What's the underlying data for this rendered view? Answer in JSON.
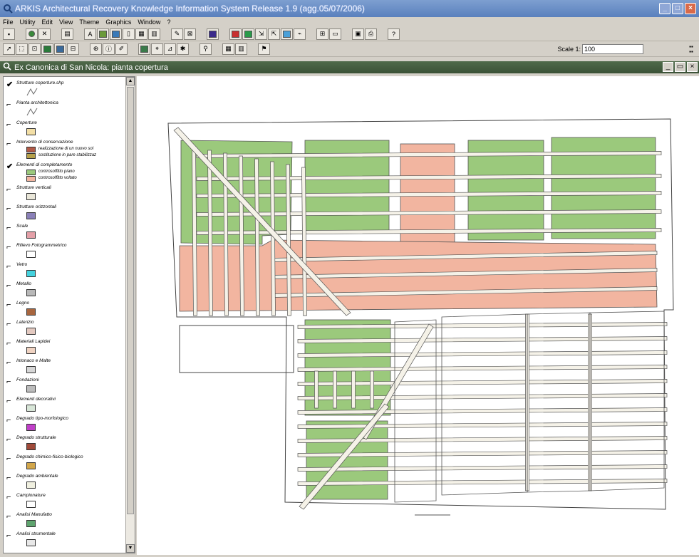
{
  "window": {
    "title": "ARKIS  Architectural Recovery Knowledge Information System      Release 1.9  (agg.05/07/2006)",
    "icon": "app-icon"
  },
  "menu": [
    "File",
    "Utility",
    "Edit",
    "View",
    "Theme",
    "Graphics",
    "Window",
    "?"
  ],
  "toolbar": {
    "scale_label": "Scale 1:",
    "scale_value": "100"
  },
  "map_window": {
    "title": "Ex Canonica di San Nicola: pianta copertura"
  },
  "legend": {
    "items": [
      {
        "label": "Strutture coperture.shp",
        "checked": true,
        "swatch_type": "line",
        "color": "#6b6b6b"
      },
      {
        "label": "Pianta architettonica",
        "checked": false,
        "swatch_type": "line",
        "color": "#6b6b6b"
      },
      {
        "label": "Coperture",
        "checked": false,
        "swatch_type": "fill",
        "color": "#f3dfa6"
      },
      {
        "label": "Intervento di conservazione",
        "checked": false,
        "swatch_type": "group",
        "subitems": [
          {
            "label": "realizzazione di un nuovo sol",
            "color": "#b25a47"
          },
          {
            "label": "sostituzione in pare stabilizzaz",
            "color": "#b5a04a"
          }
        ]
      },
      {
        "label": "Elementi di completamento",
        "checked": true,
        "swatch_type": "group",
        "subitems": [
          {
            "label": "controsoffitto piano",
            "color": "#9bc97c"
          },
          {
            "label": "controsoffitto voltato",
            "color": "#f2b5a0"
          }
        ]
      },
      {
        "label": "Strutture verticali",
        "checked": false,
        "swatch_type": "fill",
        "color": "#e9e6d8"
      },
      {
        "label": "Strutture orizzontali",
        "checked": false,
        "swatch_type": "fill",
        "color": "#8a80b8"
      },
      {
        "label": "Scale",
        "checked": false,
        "swatch_type": "fill",
        "color": "#e4a0a8"
      },
      {
        "label": "Rilievo Fotogrammetrico",
        "checked": false,
        "swatch_type": "fill",
        "color": "#ffffff"
      },
      {
        "label": "Vetro",
        "checked": false,
        "swatch_type": "fill",
        "color": "#44d2de"
      },
      {
        "label": "Metallo",
        "checked": false,
        "swatch_type": "fill",
        "color": "#b8b8b8"
      },
      {
        "label": "Legno",
        "checked": false,
        "swatch_type": "fill",
        "color": "#a8663f"
      },
      {
        "label": "Laterizio",
        "checked": false,
        "swatch_type": "fill",
        "color": "#e3c9c0"
      },
      {
        "label": "Materiali Lapidei",
        "checked": false,
        "swatch_type": "fill",
        "color": "#f0d3c2"
      },
      {
        "label": "Intonaco e Malte",
        "checked": false,
        "swatch_type": "fill",
        "color": "#d6d6d6"
      },
      {
        "label": "Fondazioni",
        "checked": false,
        "swatch_type": "fill",
        "color": "#bcbcbc"
      },
      {
        "label": "Elementi decorativi",
        "checked": false,
        "swatch_type": "fill",
        "color": "#d8e6d8"
      },
      {
        "label": "Degrado tipo-morfologico",
        "checked": false,
        "swatch_type": "fill",
        "color": "#c040c8"
      },
      {
        "label": "Degrado strutturale",
        "checked": false,
        "swatch_type": "fill",
        "color": "#a04a3a"
      },
      {
        "label": "Degrado chimico-fisico-biologico",
        "checked": false,
        "swatch_type": "fill",
        "color": "#d2a64a"
      },
      {
        "label": "Degrado ambientale",
        "checked": false,
        "swatch_type": "fill",
        "color": "#f0f0e0"
      },
      {
        "label": "Campionature",
        "checked": false,
        "swatch_type": "fill",
        "color": "#ffffff"
      },
      {
        "label": "Analisi Manufatto",
        "checked": false,
        "swatch_type": "fill",
        "color": "#5ea46e"
      },
      {
        "label": "Analisi strumentale",
        "checked": false,
        "swatch_type": "fill",
        "color": "#e8e8e8"
      }
    ]
  },
  "colors": {
    "green_fill": "#9bc97c",
    "pink_fill": "#f2b5a0",
    "outline": "#333333"
  }
}
